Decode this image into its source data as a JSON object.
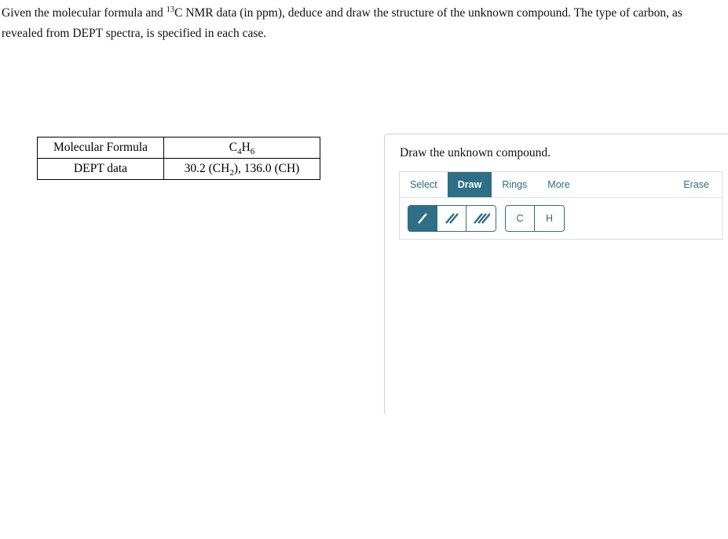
{
  "prompt": {
    "line1_part1": "Given the molecular formula and ",
    "isotope": "13",
    "line1_part2": "C NMR data (in ppm), deduce and draw the structure of the unknown compound. The type of carbon, as revealed from DEPT spectra, is specified in each case."
  },
  "table": {
    "rows": [
      {
        "label": "Molecular Formula",
        "value_prefix": "C",
        "value_sub1": "4",
        "value_mid": "H",
        "value_sub2": "6"
      },
      {
        "label": "DEPT data",
        "value_prefix": "30.2 (CH",
        "value_sub1": "2",
        "value_mid": "), 136.0 (CH)",
        "value_sub2": ""
      }
    ]
  },
  "answer_panel": {
    "instruction": "Draw the unknown compound.",
    "sketcher": {
      "tabs": [
        {
          "label": "Select",
          "active": false
        },
        {
          "label": "Draw",
          "active": true
        },
        {
          "label": "Rings",
          "active": false
        },
        {
          "label": "More",
          "active": false
        }
      ],
      "erase_label": "Erase",
      "bond_tools": [
        {
          "name": "single-bond",
          "active": true
        },
        {
          "name": "double-bond",
          "active": false
        },
        {
          "name": "triple-bond",
          "active": false
        }
      ],
      "element_tools": [
        {
          "label": "C",
          "active": false
        },
        {
          "label": "H",
          "active": false
        }
      ]
    }
  },
  "colors": {
    "accent_teal": "#2e6e86",
    "link_teal": "#2c6b83",
    "panel_border": "#cfcfcf",
    "scrollbar": "#8c8c8c"
  }
}
